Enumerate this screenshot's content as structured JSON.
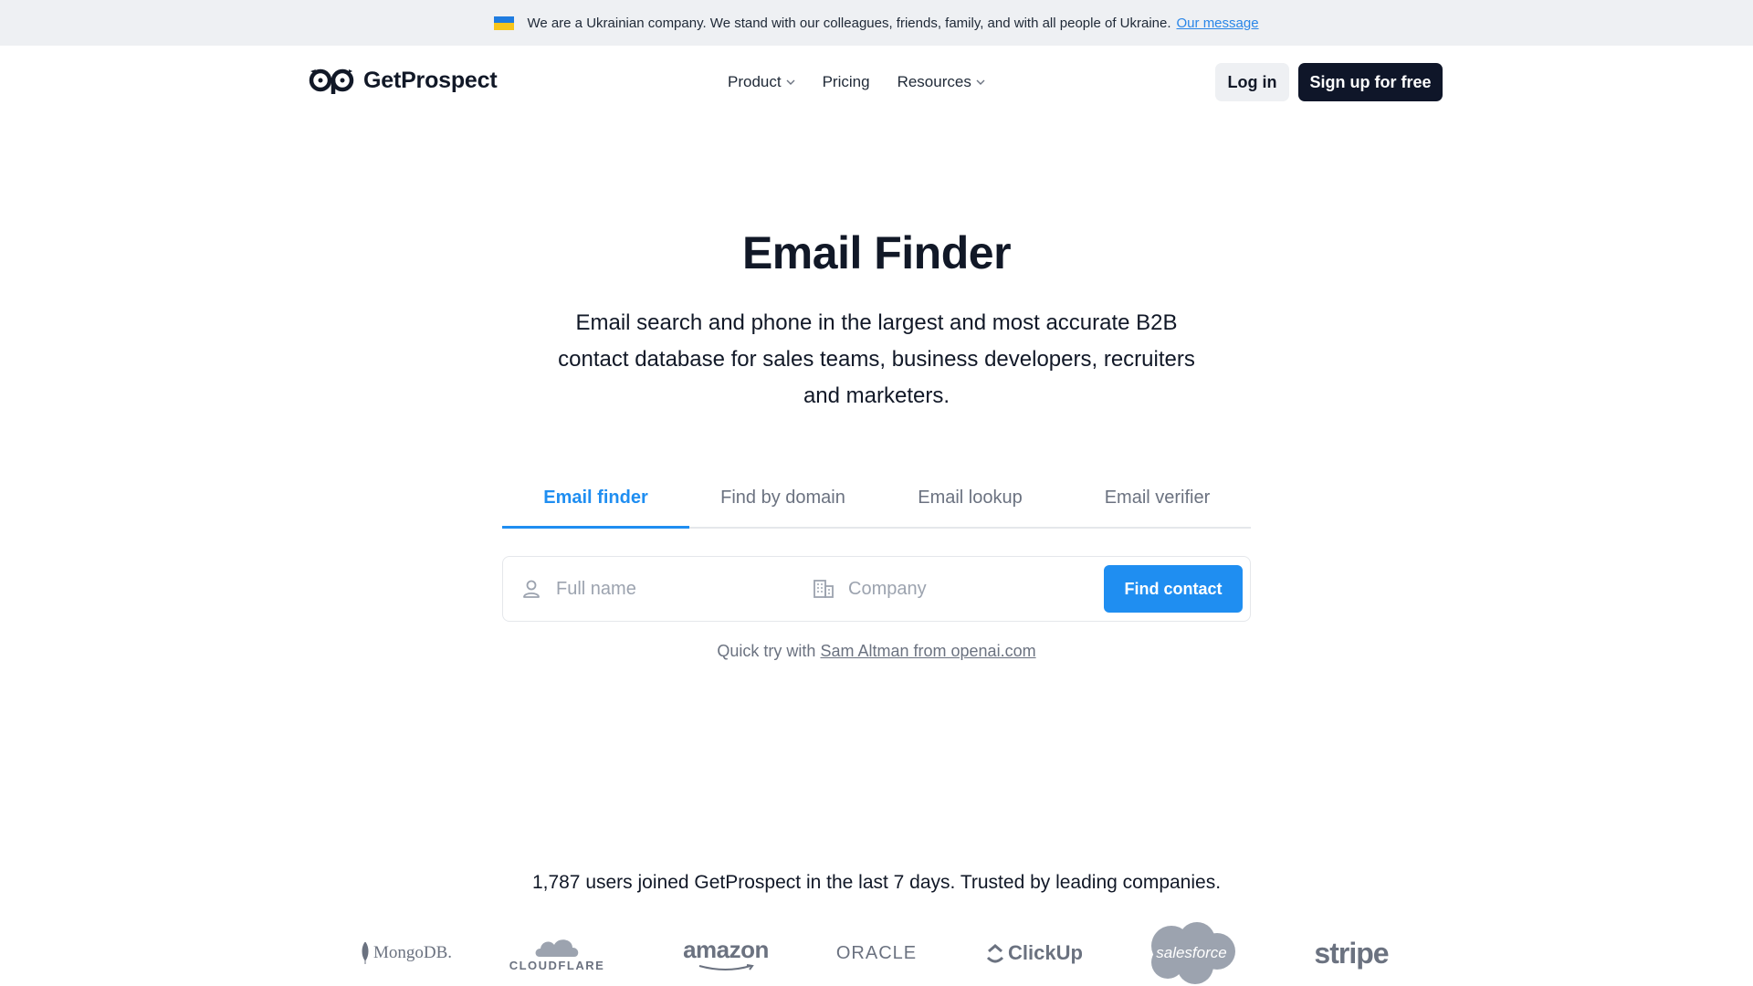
{
  "banner": {
    "message": "We are a Ukrainian company. We stand with our colleagues, friends, family, and with all people of Ukraine.",
    "link": "Our message"
  },
  "header": {
    "brand": "GetProspect",
    "nav": [
      {
        "label": "Product",
        "icon": "chevron-down-icon"
      },
      {
        "label": "Pricing"
      },
      {
        "label": "Resources",
        "icon": "chevron-down-icon"
      }
    ],
    "login": "Log in",
    "signup": "Sign up for free"
  },
  "hero": {
    "title": "Email Finder",
    "subtitle": "Email search and phone in the largest and most accurate B2B contact database for sales teams, business developers, recruiters and marketers."
  },
  "tabs": [
    {
      "label": "Email finder",
      "active": true
    },
    {
      "label": "Find by domain",
      "active": false
    },
    {
      "label": "Email lookup",
      "active": false
    },
    {
      "label": "Email verifier",
      "active": false
    }
  ],
  "search": {
    "name_placeholder": "Full name",
    "company_placeholder": "Company",
    "button": "Find contact",
    "quick_prefix": "Quick try with",
    "quick_link": "Sam Altman from openai.com"
  },
  "trust": {
    "text": "1,787 users joined GetProspect in the last 7 days. Trusted by leading companies.",
    "logos": [
      "MongoDB.",
      "CLOUDFLARE",
      "amazon",
      "ORACLE",
      "ClickUp",
      "salesforce",
      "stripe"
    ]
  },
  "colors": {
    "accent": "#1f8ef1",
    "dark_button": "#0f1629",
    "banner_bg": "#eef0f3"
  }
}
